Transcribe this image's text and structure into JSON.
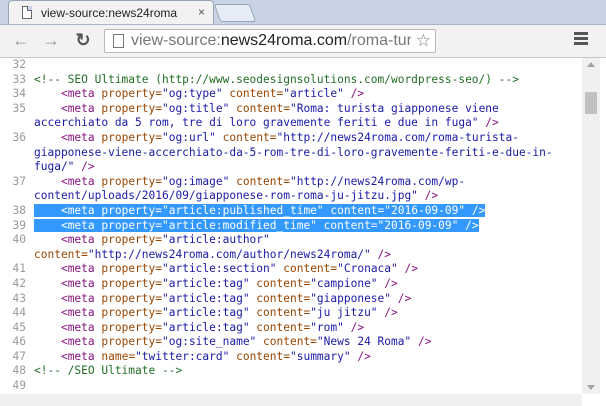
{
  "tab": {
    "title": "view-source:news24roma",
    "close": "×"
  },
  "toolbar": {
    "back": "←",
    "forward": "→",
    "reload": "↻",
    "url_prefix": "view-source:",
    "url_host": "news24roma.com",
    "url_path": "/roma-tur",
    "star": "☆"
  },
  "lines": [
    {
      "num": "32",
      "parts": []
    },
    {
      "num": "33",
      "parts": [
        {
          "c": "comment",
          "t": "<!-- SEO Ultimate (http://www.seodesignsolutions.com/wordpress-seo/) -->"
        }
      ]
    },
    {
      "num": "34",
      "parts": [
        {
          "c": "plain",
          "t": "    "
        },
        {
          "c": "tagname",
          "t": "<meta "
        },
        {
          "c": "attr",
          "t": "property="
        },
        {
          "c": "val",
          "t": "\"og:type\""
        },
        {
          "c": "attr",
          "t": " content="
        },
        {
          "c": "val",
          "t": "\"article\""
        },
        {
          "c": "tagname",
          "t": " />"
        }
      ]
    },
    {
      "num": "35",
      "parts": [
        {
          "c": "plain",
          "t": "    "
        },
        {
          "c": "tagname",
          "t": "<meta "
        },
        {
          "c": "attr",
          "t": "property="
        },
        {
          "c": "val",
          "t": "\"og:title\""
        },
        {
          "c": "attr",
          "t": " content="
        },
        {
          "c": "val",
          "t": "\"Roma: turista giapponese viene accerchiato da 5 rom, tre di loro gravemente feriti e due in fuga\""
        },
        {
          "c": "tagname",
          "t": " />"
        }
      ]
    },
    {
      "num": "36",
      "parts": [
        {
          "c": "plain",
          "t": "    "
        },
        {
          "c": "tagname",
          "t": "<meta "
        },
        {
          "c": "attr",
          "t": "property="
        },
        {
          "c": "val",
          "t": "\"og:url\""
        },
        {
          "c": "attr",
          "t": " content="
        },
        {
          "c": "val",
          "t": "\"http://news24roma.com/roma-turista-giapponese-viene-accerchiato-da-5-rom-tre-di-loro-gravemente-feriti-e-due-in-fuga/\""
        },
        {
          "c": "tagname",
          "t": " />"
        }
      ]
    },
    {
      "num": "37",
      "parts": [
        {
          "c": "plain",
          "t": "    "
        },
        {
          "c": "tagname",
          "t": "<meta "
        },
        {
          "c": "attr",
          "t": "property="
        },
        {
          "c": "val",
          "t": "\"og:image\""
        },
        {
          "c": "attr",
          "t": " content="
        },
        {
          "c": "val",
          "t": "\"http://news24roma.com/wp-content/uploads/2016/09/giapponese-rom-roma-ju-jitzu.jpg\""
        },
        {
          "c": "tagname",
          "t": " />"
        }
      ]
    },
    {
      "num": "38",
      "hl": true,
      "parts": [
        {
          "c": "plain",
          "t": "    "
        },
        {
          "c": "tagname",
          "t": "<meta "
        },
        {
          "c": "attr",
          "t": "property="
        },
        {
          "c": "val",
          "t": "\"article:published_time\""
        },
        {
          "c": "attr",
          "t": " content="
        },
        {
          "c": "val",
          "t": "\"2016-09-09\""
        },
        {
          "c": "tagname",
          "t": " />"
        }
      ]
    },
    {
      "num": "39",
      "hl": true,
      "parts": [
        {
          "c": "plain",
          "t": "    "
        },
        {
          "c": "tagname",
          "t": "<meta "
        },
        {
          "c": "attr",
          "t": "property="
        },
        {
          "c": "val",
          "t": "\"article:modified_time\""
        },
        {
          "c": "attr",
          "t": " content="
        },
        {
          "c": "val",
          "t": "\"2016-09-09\""
        },
        {
          "c": "tagname",
          "t": " />"
        }
      ]
    },
    {
      "num": "40",
      "parts": [
        {
          "c": "plain",
          "t": "    "
        },
        {
          "c": "tagname",
          "t": "<meta "
        },
        {
          "c": "attr",
          "t": "property="
        },
        {
          "c": "val",
          "t": "\"article:author\""
        },
        {
          "c": "attr",
          "t": " content="
        },
        {
          "c": "val",
          "t": "\"http://news24roma.com/author/news24roma/\""
        },
        {
          "c": "tagname",
          "t": " />"
        }
      ]
    },
    {
      "num": "41",
      "parts": [
        {
          "c": "plain",
          "t": "    "
        },
        {
          "c": "tagname",
          "t": "<meta "
        },
        {
          "c": "attr",
          "t": "property="
        },
        {
          "c": "val",
          "t": "\"article:section\""
        },
        {
          "c": "attr",
          "t": " content="
        },
        {
          "c": "val",
          "t": "\"Cronaca\""
        },
        {
          "c": "tagname",
          "t": " />"
        }
      ]
    },
    {
      "num": "42",
      "parts": [
        {
          "c": "plain",
          "t": "    "
        },
        {
          "c": "tagname",
          "t": "<meta "
        },
        {
          "c": "attr",
          "t": "property="
        },
        {
          "c": "val",
          "t": "\"article:tag\""
        },
        {
          "c": "attr",
          "t": " content="
        },
        {
          "c": "val",
          "t": "\"campione\""
        },
        {
          "c": "tagname",
          "t": " />"
        }
      ]
    },
    {
      "num": "43",
      "parts": [
        {
          "c": "plain",
          "t": "    "
        },
        {
          "c": "tagname",
          "t": "<meta "
        },
        {
          "c": "attr",
          "t": "property="
        },
        {
          "c": "val",
          "t": "\"article:tag\""
        },
        {
          "c": "attr",
          "t": " content="
        },
        {
          "c": "val",
          "t": "\"giapponese\""
        },
        {
          "c": "tagname",
          "t": " />"
        }
      ]
    },
    {
      "num": "44",
      "parts": [
        {
          "c": "plain",
          "t": "    "
        },
        {
          "c": "tagname",
          "t": "<meta "
        },
        {
          "c": "attr",
          "t": "property="
        },
        {
          "c": "val",
          "t": "\"article:tag\""
        },
        {
          "c": "attr",
          "t": " content="
        },
        {
          "c": "val",
          "t": "\"ju jitzu\""
        },
        {
          "c": "tagname",
          "t": " />"
        }
      ]
    },
    {
      "num": "45",
      "parts": [
        {
          "c": "plain",
          "t": "    "
        },
        {
          "c": "tagname",
          "t": "<meta "
        },
        {
          "c": "attr",
          "t": "property="
        },
        {
          "c": "val",
          "t": "\"article:tag\""
        },
        {
          "c": "attr",
          "t": " content="
        },
        {
          "c": "val",
          "t": "\"rom\""
        },
        {
          "c": "tagname",
          "t": " />"
        }
      ]
    },
    {
      "num": "46",
      "parts": [
        {
          "c": "plain",
          "t": "    "
        },
        {
          "c": "tagname",
          "t": "<meta "
        },
        {
          "c": "attr",
          "t": "property="
        },
        {
          "c": "val",
          "t": "\"og:site_name\""
        },
        {
          "c": "attr",
          "t": " content="
        },
        {
          "c": "val",
          "t": "\"News 24 Roma\""
        },
        {
          "c": "tagname",
          "t": " />"
        }
      ]
    },
    {
      "num": "47",
      "parts": [
        {
          "c": "plain",
          "t": "    "
        },
        {
          "c": "tagname",
          "t": "<meta "
        },
        {
          "c": "attr",
          "t": "name="
        },
        {
          "c": "val",
          "t": "\"twitter:card\""
        },
        {
          "c": "attr",
          "t": " content="
        },
        {
          "c": "val",
          "t": "\"summary\""
        },
        {
          "c": "tagname",
          "t": " />"
        }
      ]
    },
    {
      "num": "48",
      "parts": [
        {
          "c": "comment",
          "t": "<!-- /SEO Ultimate -->"
        }
      ]
    },
    {
      "num": "49",
      "parts": []
    }
  ]
}
